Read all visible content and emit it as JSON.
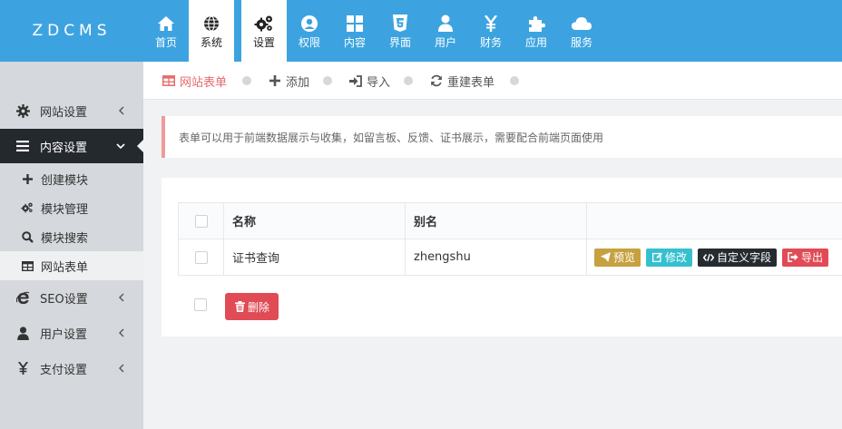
{
  "app": {
    "logo": "ZDCMS"
  },
  "nav": [
    {
      "label": "首页",
      "icon": "home-icon"
    },
    {
      "label": "系统",
      "icon": "globe-icon",
      "active": true
    },
    {
      "label": "设置",
      "icon": "gears-icon",
      "active": true
    },
    {
      "label": "权限",
      "icon": "user-circle-icon"
    },
    {
      "label": "内容",
      "icon": "grid-icon"
    },
    {
      "label": "界面",
      "icon": "html5-icon"
    },
    {
      "label": "用户",
      "icon": "user-icon"
    },
    {
      "label": "财务",
      "icon": "yen-icon"
    },
    {
      "label": "应用",
      "icon": "puzzle-icon"
    },
    {
      "label": "服务",
      "icon": "cloud-icon"
    }
  ],
  "sidebar": {
    "items": [
      {
        "label": "网站设置",
        "icon": "gear-icon"
      },
      {
        "label": "内容设置",
        "icon": "bars-icon"
      },
      {
        "label": "SEO设置",
        "icon": "ie-icon"
      },
      {
        "label": "用户设置",
        "icon": "user-icon"
      },
      {
        "label": "支付设置",
        "icon": "yen-icon"
      }
    ],
    "sub_items": [
      {
        "label": "创建模块",
        "icon": "plus-icon"
      },
      {
        "label": "模块管理",
        "icon": "gears-icon"
      },
      {
        "label": "模块搜索",
        "icon": "search-icon"
      },
      {
        "label": "网站表单",
        "icon": "table-icon"
      }
    ]
  },
  "actionbar": {
    "form_label": "网站表单",
    "add_label": "添加",
    "import_label": "导入",
    "rebuild_label": "重建表单"
  },
  "alert": {
    "text": "表单可以用于前端数据展示与收集，如留言板、反馈、证书展示，需要配合前端页面使用"
  },
  "table": {
    "headers": [
      "名称",
      "别名"
    ],
    "rows": [
      {
        "name": "证书查询",
        "alias": "zhengshu"
      }
    ],
    "row_actions": {
      "preview": "预览",
      "edit": "修改",
      "custom_fields": "自定义字段",
      "export": "导出"
    },
    "delete_label": "删除"
  },
  "colors": {
    "topbar": "#3da3e0",
    "sidebar": "#d5d8dc",
    "sidebar_open": "#24292e",
    "preview": "#c6a13f",
    "edit": "#35c0cf",
    "custom_fields": "#262b30",
    "danger": "#e04b55"
  }
}
